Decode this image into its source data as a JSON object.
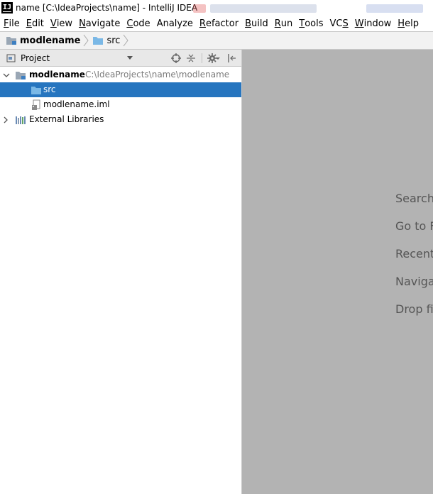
{
  "window": {
    "title": "name [C:\\IdeaProjects\\name] - IntelliJ IDEA",
    "app_icon_text": "IJ"
  },
  "menu": {
    "items": [
      {
        "label": "File",
        "mnemonic": "F"
      },
      {
        "label": "Edit",
        "mnemonic": "E"
      },
      {
        "label": "View",
        "mnemonic": "V"
      },
      {
        "label": "Navigate",
        "mnemonic": "N"
      },
      {
        "label": "Code",
        "mnemonic": "C"
      },
      {
        "label": "Analyze",
        "mnemonic": ""
      },
      {
        "label": "Refactor",
        "mnemonic": "R"
      },
      {
        "label": "Build",
        "mnemonic": "B"
      },
      {
        "label": "Run",
        "mnemonic": "R"
      },
      {
        "label": "Tools",
        "mnemonic": "T"
      },
      {
        "label": "VCS",
        "mnemonic": "S"
      },
      {
        "label": "Window",
        "mnemonic": "W"
      },
      {
        "label": "Help",
        "mnemonic": "H"
      }
    ]
  },
  "breadcrumb": {
    "items": [
      "modlename",
      "src"
    ]
  },
  "project_panel": {
    "title": "Project",
    "icons": [
      "locate-icon",
      "collapse-all-icon",
      "settings-gear-icon",
      "hide-panel-icon"
    ]
  },
  "tree": {
    "module_name": "modlename",
    "module_path": "C:\\IdeaProjects\\name\\modlename",
    "src_folder": "src",
    "iml_file": "modlename.iml",
    "external_libraries": "External Libraries"
  },
  "editor": {
    "hints": [
      "Search",
      "Go to F",
      "Recent",
      "Naviga",
      "Drop fi"
    ]
  },
  "colors": {
    "selection": "#2675bf",
    "editor_bg": "#b3b3b3",
    "folder_blue": "#5fa8e0",
    "panel_header_bg": "#e8e8e8"
  }
}
